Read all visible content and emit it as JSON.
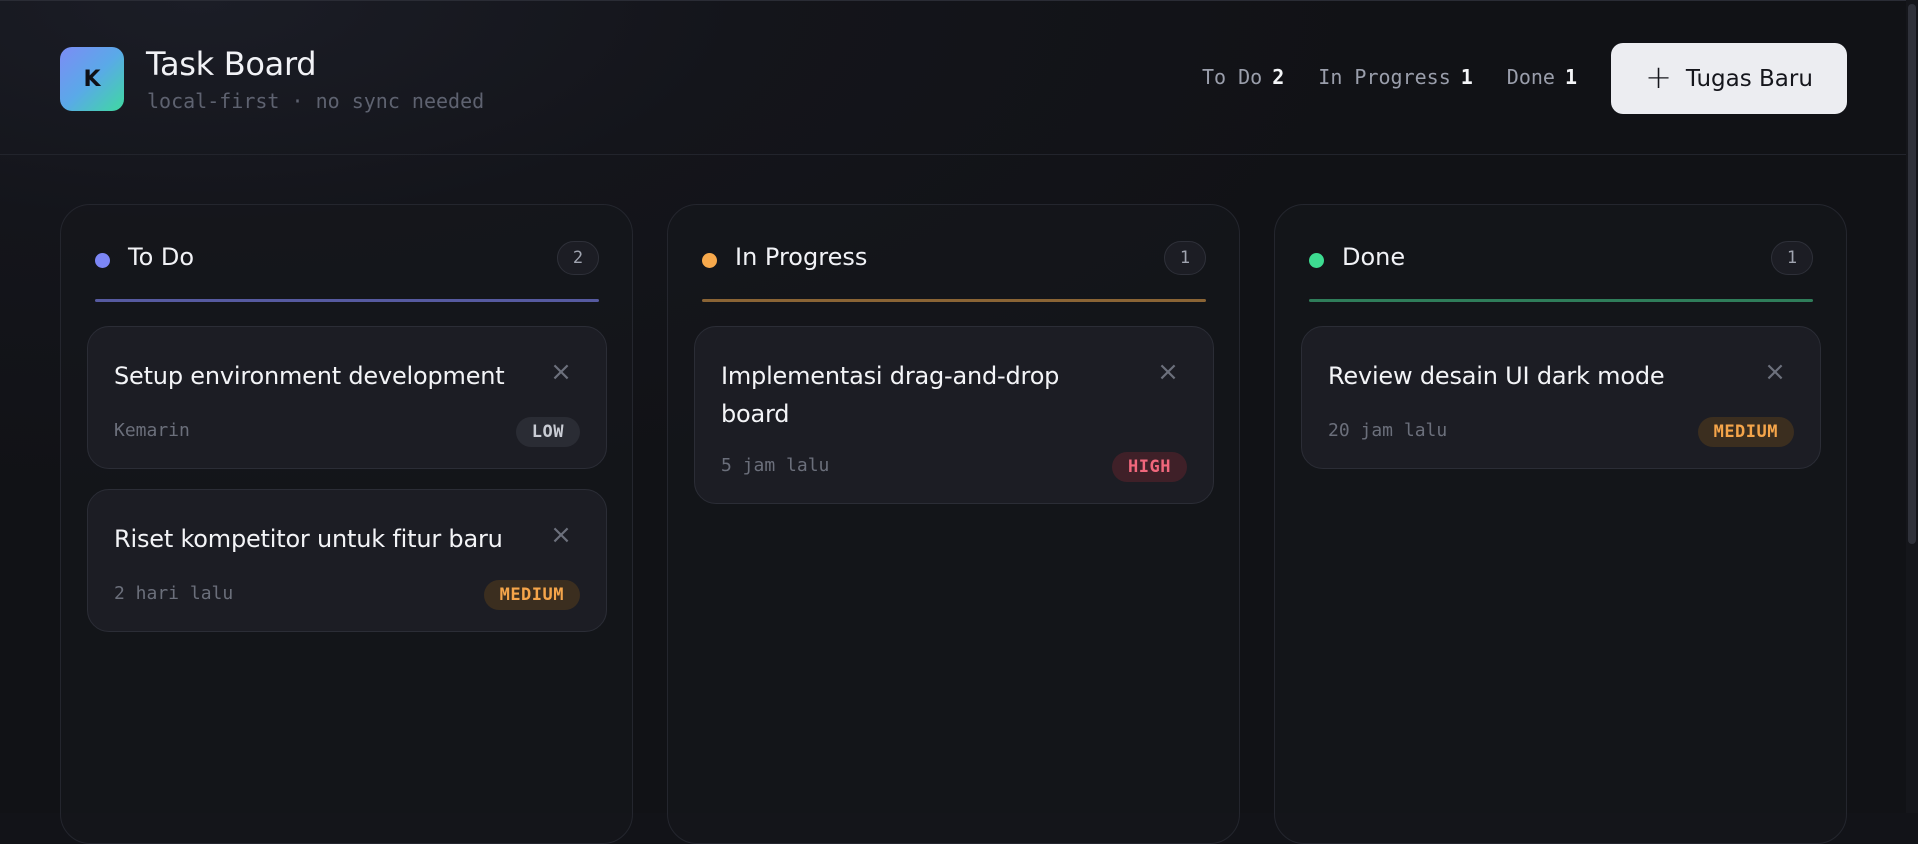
{
  "app": {
    "logo_letter": "K",
    "title": "Task Board",
    "subtitle": "local-first · no sync needed"
  },
  "stats": [
    {
      "label": "To Do",
      "count": "2"
    },
    {
      "label": "In Progress",
      "count": "1"
    },
    {
      "label": "Done",
      "count": "1"
    }
  ],
  "new_task_button": {
    "icon": "plus-icon",
    "label": "Tugas Baru"
  },
  "columns": [
    {
      "title": "To Do",
      "count": "2",
      "color": "#7c86f5",
      "line_color": "#565aa0",
      "cards": [
        {
          "title": "Setup environment development",
          "time": "Kemarin",
          "priority": "LOW"
        },
        {
          "title": "Riset kompetitor untuk fitur baru",
          "time": "2 hari lalu",
          "priority": "MEDIUM"
        }
      ]
    },
    {
      "title": "In Progress",
      "count": "1",
      "color": "#f7a94c",
      "line_color": "#8a6435",
      "cards": [
        {
          "title": "Implementasi drag-and-drop board",
          "time": "5 jam lalu",
          "priority": "HIGH"
        }
      ]
    },
    {
      "title": "Done",
      "count": "1",
      "color": "#3ddc91",
      "line_color": "#2f7d5a",
      "cards": [
        {
          "title": "Review desain UI dark mode",
          "time": "20 jam lalu",
          "priority": "MEDIUM"
        }
      ]
    }
  ],
  "close_icon": "close-icon"
}
